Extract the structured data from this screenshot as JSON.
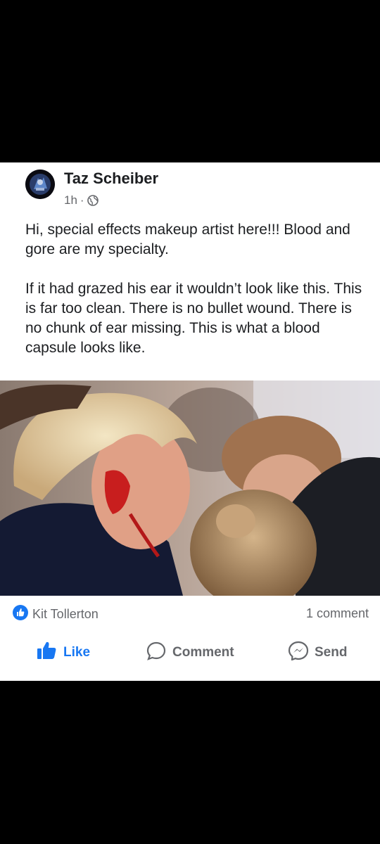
{
  "post": {
    "author": "Taz Scheiber",
    "time": "1h",
    "separator": "·",
    "paragraphs": [
      "Hi, special effects makeup artist here!!! Blood and gore are my specialty.",
      "If it had grazed his ear it wouldn’t look like this. This is far too clean. There is no bullet wound. There is no chunk of ear missing. This is what a blood capsule looks like."
    ],
    "privacy_icon": "globe-icon"
  },
  "footer": {
    "reactor": "Kit Tollerton",
    "reaction_icon": "like-reaction-icon",
    "comment_count": "1 comment"
  },
  "actions": {
    "like_label": "Like",
    "comment_label": "Comment",
    "send_label": "Send"
  },
  "colors": {
    "accent": "#1877f2",
    "secondary_text": "#65676b",
    "primary_text": "#1c1e21"
  }
}
